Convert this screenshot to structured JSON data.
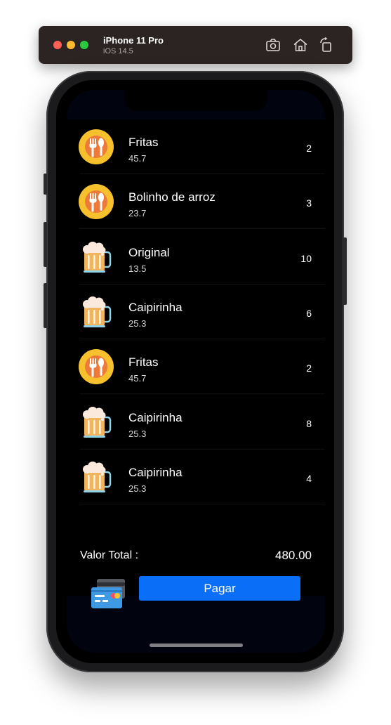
{
  "simulator": {
    "device": "iPhone 11 Pro",
    "os": "iOS 14.5",
    "tools": [
      "screenshot-icon",
      "home-icon",
      "rotate-icon"
    ]
  },
  "order": {
    "items": [
      {
        "name": "Fritas",
        "price": "45.7",
        "quantity": "2",
        "icon": "food-icon"
      },
      {
        "name": "Bolinho de arroz",
        "price": "23.7",
        "quantity": "3",
        "icon": "food-icon"
      },
      {
        "name": "Original",
        "price": "13.5",
        "quantity": "10",
        "icon": "beer-icon"
      },
      {
        "name": "Caipirinha",
        "price": "25.3",
        "quantity": "6",
        "icon": "beer-icon"
      },
      {
        "name": "Fritas",
        "price": "45.7",
        "quantity": "2",
        "icon": "food-icon"
      },
      {
        "name": "Caipirinha",
        "price": "25.3",
        "quantity": "8",
        "icon": "beer-icon"
      },
      {
        "name": "Caipirinha",
        "price": "25.3",
        "quantity": "4",
        "icon": "beer-icon"
      }
    ],
    "total_label": "Valor Total :",
    "total_value": "480.00",
    "pay_label": "Pagar",
    "payment_icon": "credit-card-icon"
  },
  "colors": {
    "accent": "#0a6ff6",
    "screen_background": "#000000",
    "food_icon": "#f6c12c",
    "beer_icon": "#f2b45c"
  }
}
